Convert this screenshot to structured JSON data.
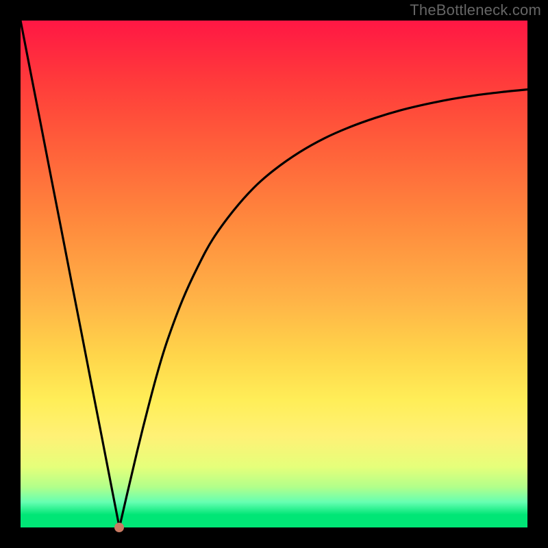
{
  "watermark": "TheBottleneck.com",
  "colors": {
    "frame": "#000000",
    "curve": "#000000",
    "marker": "#c97a63"
  },
  "chart_data": {
    "type": "line",
    "title": "",
    "xlabel": "",
    "ylabel": "",
    "xlim": [
      0,
      100
    ],
    "ylim": [
      0,
      100
    ],
    "x": [
      0,
      2,
      4,
      6,
      8,
      10,
      12,
      14,
      16,
      18,
      19.5,
      21,
      23,
      25,
      27,
      29,
      32,
      35,
      38,
      42,
      46,
      50,
      55,
      60,
      65,
      70,
      75,
      80,
      85,
      90,
      95,
      100
    ],
    "values": [
      100,
      89.7,
      79.5,
      69.2,
      59.0,
      48.7,
      38.5,
      28.2,
      18.0,
      7.7,
      0,
      6.5,
      15.0,
      23.0,
      30.5,
      37.0,
      45.0,
      51.5,
      57.0,
      62.5,
      67.0,
      70.5,
      74.0,
      76.8,
      79.0,
      80.8,
      82.3,
      83.5,
      84.5,
      85.3,
      85.9,
      86.4
    ],
    "marker": {
      "x": 19.5,
      "y": 0
    },
    "grid": false,
    "legend": false
  }
}
